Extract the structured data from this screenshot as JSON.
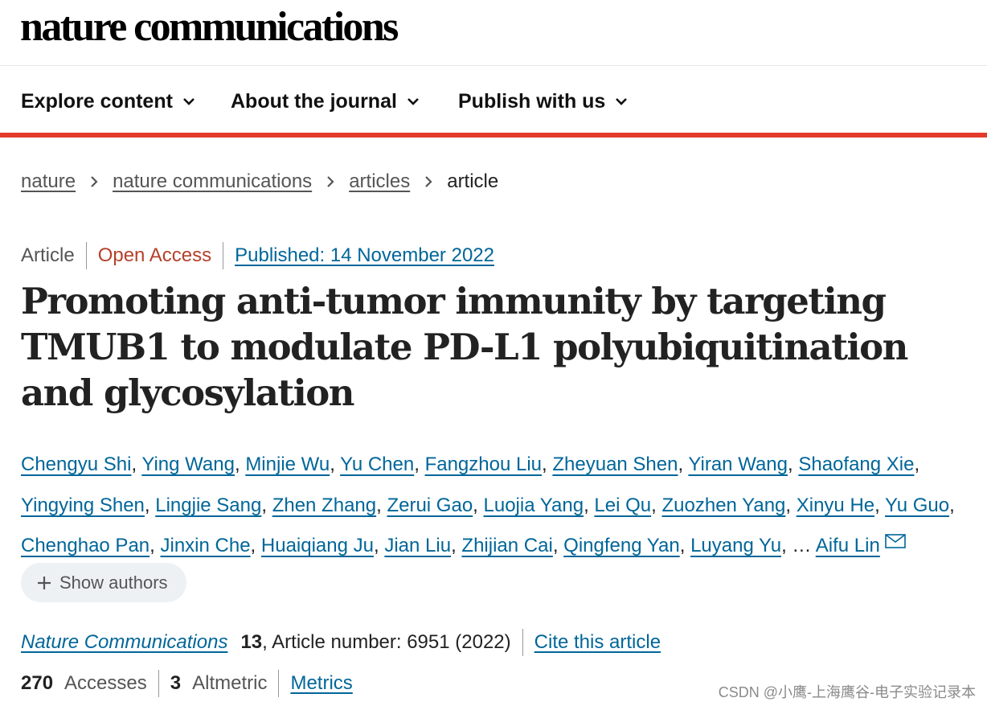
{
  "header": {
    "logo": "nature communications"
  },
  "nav": {
    "items": [
      {
        "label": "Explore content"
      },
      {
        "label": "About the journal"
      },
      {
        "label": "Publish with us"
      }
    ]
  },
  "breadcrumb": {
    "items": [
      "nature",
      "nature communications",
      "articles"
    ],
    "current": "article"
  },
  "article": {
    "type": "Article",
    "access": "Open Access",
    "published": "Published: 14 November 2022",
    "title": "Promoting anti-tumor immunity by targeting TMUB1 to modulate PD-L1 polyubiquitination and glycosylation",
    "authors": [
      "Chengyu Shi",
      "Ying Wang",
      "Minjie Wu",
      "Yu Chen",
      "Fangzhou Liu",
      "Zheyuan Shen",
      "Yiran Wang",
      "Shaofang Xie",
      "Yingying Shen",
      "Lingjie Sang",
      "Zhen Zhang",
      "Zerui Gao",
      "Luojia Yang",
      "Lei Qu",
      "Zuozhen Yang",
      "Xinyu He",
      "Yu Guo",
      "Chenghao Pan",
      "Jinxin Che",
      "Huaiqiang Ju",
      "Jian Liu",
      "Zhijian Cai",
      "Qingfeng Yan",
      "Luyang Yu"
    ],
    "ellipsis": "…",
    "last_author": "Aifu Lin",
    "show_authors": "Show authors",
    "journal": "Nature Communications",
    "volume": "13",
    "article_number": ", Article number: 6951 (2022)",
    "cite": "Cite this article",
    "accesses_count": "270",
    "accesses_label": "Accesses",
    "altmetric_count": "3",
    "altmetric_label": "Altmetric",
    "metrics_link": "Metrics"
  },
  "watermark": "CSDN @小鹰-上海鹰谷-电子实验记录本",
  "colors": {
    "link": "#006699",
    "accent": "#e43a2b",
    "open_access": "#b5412a"
  }
}
